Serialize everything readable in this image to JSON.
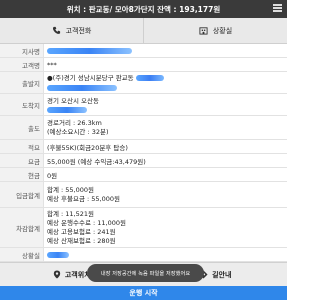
{
  "topbar": {
    "title": "위치 : 판교동/ 모아8가단지 잔액 : 193,177원"
  },
  "header_buttons": {
    "call": "고객전화",
    "status": "상황실"
  },
  "rows": {
    "dispatch_label": "지사명",
    "customer_label": "고객명",
    "customer_value": "***",
    "origin_label": "출발지",
    "origin_value": "●(주)경기 성남시분당구 판교동",
    "destination_label": "도착지",
    "destination_value": "경기 오산시 오산동",
    "route_label": "출도",
    "route_line1": "경로거리 : 26.3km",
    "route_line2": "(예상소요시간 : 32분)",
    "memo_label": "적요",
    "memo_value": "(후불55K)(회금20분후 탑승)",
    "fare_label": "요금",
    "fare_value": "55,000원 (예상 수익금:43,479원)",
    "cash_label": "현금",
    "cash_value": "0원",
    "deposit_label": "입금합계",
    "deposit_line1": "합계 : 55,000원",
    "deposit_line2": "예상 후불요금 : 55,000원",
    "deduct_label": "차감합계",
    "deduct_line1": "합계 : 11,521원",
    "deduct_line2": "예상 운행수수료 : 11,000원",
    "deduct_line3": "예상 고용보험료 : 241원",
    "deduct_line4": "예상 산재보험료 : 280원",
    "situation_label": "상황실"
  },
  "actions": {
    "customer_location": "고객위치",
    "navigation": "길안내"
  },
  "toast": {
    "text": "내장 저장공간에 녹음 파일을 저장했어요"
  },
  "bottom": {
    "start": "운행 시작"
  }
}
